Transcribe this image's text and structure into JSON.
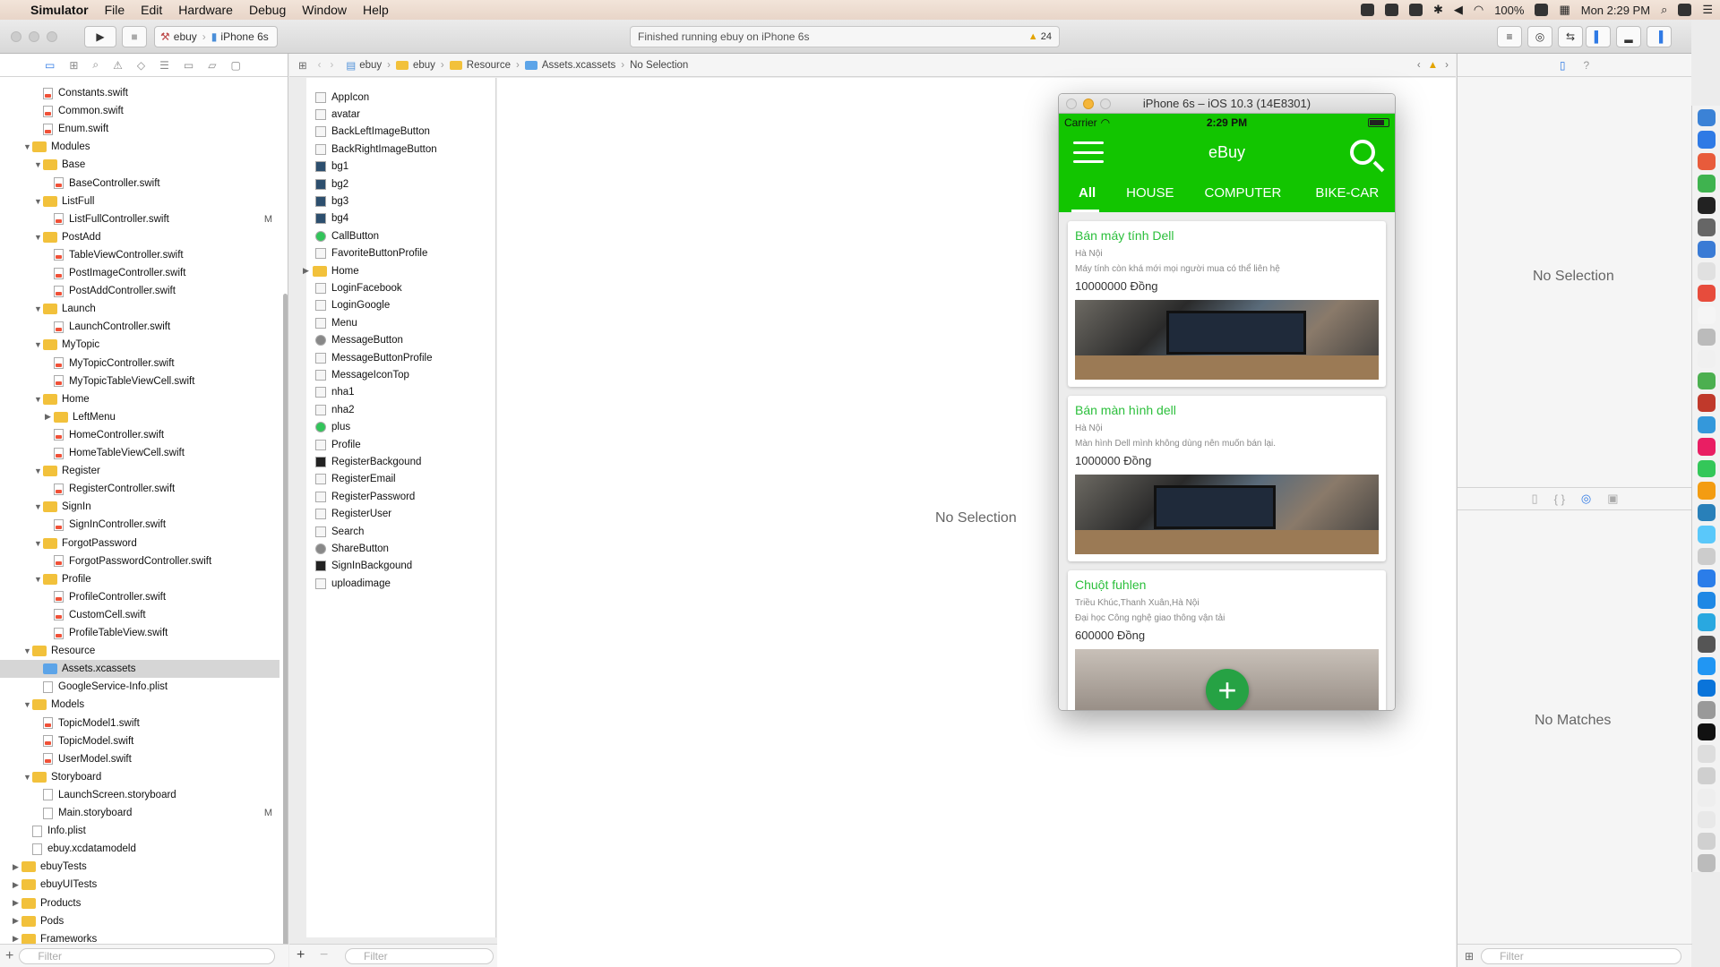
{
  "menubar": {
    "app": "Simulator",
    "items": [
      "File",
      "Edit",
      "Hardware",
      "Debug",
      "Window",
      "Help"
    ],
    "battery": "100%",
    "clock": "Mon 2:29 PM"
  },
  "toolbar": {
    "scheme": "ebuy",
    "device": "iPhone 6s",
    "status": "Finished running ebuy on iPhone 6s",
    "warnings": "24"
  },
  "navigator": {
    "rows": [
      {
        "label": "Constants.swift",
        "indent": 2,
        "kind": "swift"
      },
      {
        "label": "Common.swift",
        "indent": 2,
        "kind": "swift"
      },
      {
        "label": "Enum.swift",
        "indent": 2,
        "kind": "swift"
      },
      {
        "label": "Modules",
        "indent": 1,
        "kind": "folder",
        "open": true
      },
      {
        "label": "Base",
        "indent": 2,
        "kind": "folder",
        "open": true
      },
      {
        "label": "BaseController.swift",
        "indent": 3,
        "kind": "swift"
      },
      {
        "label": "ListFull",
        "indent": 2,
        "kind": "folder",
        "open": true
      },
      {
        "label": "ListFullController.swift",
        "indent": 3,
        "kind": "swift",
        "badge": "M"
      },
      {
        "label": "PostAdd",
        "indent": 2,
        "kind": "folder",
        "open": true
      },
      {
        "label": "TableViewController.swift",
        "indent": 3,
        "kind": "swift"
      },
      {
        "label": "PostImageController.swift",
        "indent": 3,
        "kind": "swift"
      },
      {
        "label": "PostAddController.swift",
        "indent": 3,
        "kind": "swift"
      },
      {
        "label": "Launch",
        "indent": 2,
        "kind": "folder",
        "open": true
      },
      {
        "label": "LaunchController.swift",
        "indent": 3,
        "kind": "swift"
      },
      {
        "label": "MyTopic",
        "indent": 2,
        "kind": "folder",
        "open": true
      },
      {
        "label": "MyTopicController.swift",
        "indent": 3,
        "kind": "swift"
      },
      {
        "label": "MyTopicTableViewCell.swift",
        "indent": 3,
        "kind": "swift"
      },
      {
        "label": "Home",
        "indent": 2,
        "kind": "folder",
        "open": true
      },
      {
        "label": "LeftMenu",
        "indent": 3,
        "kind": "folder",
        "open": false
      },
      {
        "label": "HomeController.swift",
        "indent": 3,
        "kind": "swift"
      },
      {
        "label": "HomeTableViewCell.swift",
        "indent": 3,
        "kind": "swift"
      },
      {
        "label": "Register",
        "indent": 2,
        "kind": "folder",
        "open": true
      },
      {
        "label": "RegisterController.swift",
        "indent": 3,
        "kind": "swift"
      },
      {
        "label": "SignIn",
        "indent": 2,
        "kind": "folder",
        "open": true
      },
      {
        "label": "SignInController.swift",
        "indent": 3,
        "kind": "swift"
      },
      {
        "label": "ForgotPassword",
        "indent": 2,
        "kind": "folder",
        "open": true
      },
      {
        "label": "ForgotPasswordController.swift",
        "indent": 3,
        "kind": "swift"
      },
      {
        "label": "Profile",
        "indent": 2,
        "kind": "folder",
        "open": true
      },
      {
        "label": "ProfileController.swift",
        "indent": 3,
        "kind": "swift"
      },
      {
        "label": "CustomCell.swift",
        "indent": 3,
        "kind": "swift"
      },
      {
        "label": "ProfileTableView.swift",
        "indent": 3,
        "kind": "swift"
      },
      {
        "label": "Resource",
        "indent": 1,
        "kind": "folder",
        "open": true
      },
      {
        "label": "Assets.xcassets",
        "indent": 2,
        "kind": "assets",
        "selected": true
      },
      {
        "label": "GoogleService-Info.plist",
        "indent": 2,
        "kind": "file"
      },
      {
        "label": "Models",
        "indent": 1,
        "kind": "folder",
        "open": true
      },
      {
        "label": "TopicModel1.swift",
        "indent": 2,
        "kind": "swift"
      },
      {
        "label": "TopicModel.swift",
        "indent": 2,
        "kind": "swift"
      },
      {
        "label": "UserModel.swift",
        "indent": 2,
        "kind": "swift"
      },
      {
        "label": "Storyboard",
        "indent": 1,
        "kind": "folder",
        "open": true
      },
      {
        "label": "LaunchScreen.storyboard",
        "indent": 2,
        "kind": "file"
      },
      {
        "label": "Main.storyboard",
        "indent": 2,
        "kind": "file",
        "badge": "M"
      },
      {
        "label": "Info.plist",
        "indent": 1,
        "kind": "file"
      },
      {
        "label": "ebuy.xcdatamodeld",
        "indent": 1,
        "kind": "file"
      },
      {
        "label": "ebuyTests",
        "indent": 0,
        "kind": "folder",
        "open": false
      },
      {
        "label": "ebuyUITests",
        "indent": 0,
        "kind": "folder",
        "open": false
      },
      {
        "label": "Products",
        "indent": 0,
        "kind": "folder",
        "open": false
      },
      {
        "label": "Pods",
        "indent": 0,
        "kind": "folder",
        "open": false
      },
      {
        "label": "Frameworks",
        "indent": 0,
        "kind": "folder",
        "open": false
      }
    ],
    "filter_placeholder": "Filter"
  },
  "jumpbar": {
    "crumbs": [
      "ebuy",
      "ebuy",
      "Resource",
      "Assets.xcassets",
      "No Selection"
    ]
  },
  "assets": {
    "items": [
      {
        "label": "AppIcon",
        "thumb": "plain"
      },
      {
        "label": "avatar",
        "thumb": "plain"
      },
      {
        "label": "BackLeftImageButton",
        "thumb": "plain"
      },
      {
        "label": "BackRightImageButton",
        "thumb": "plain"
      },
      {
        "label": "bg1",
        "thumb": "img"
      },
      {
        "label": "bg2",
        "thumb": "img"
      },
      {
        "label": "bg3",
        "thumb": "img"
      },
      {
        "label": "bg4",
        "thumb": "img"
      },
      {
        "label": "CallButton",
        "thumb": "green"
      },
      {
        "label": "FavoriteButtonProfile",
        "thumb": "plain"
      },
      {
        "label": "Home",
        "thumb": "folder"
      },
      {
        "label": "LoginFacebook",
        "thumb": "plain"
      },
      {
        "label": "LoginGoogle",
        "thumb": "plain"
      },
      {
        "label": "Menu",
        "thumb": "plain"
      },
      {
        "label": "MessageButton",
        "thumb": "gray"
      },
      {
        "label": "MessageButtonProfile",
        "thumb": "plain"
      },
      {
        "label": "MessageIconTop",
        "thumb": "plain"
      },
      {
        "label": "nha1",
        "thumb": "plain"
      },
      {
        "label": "nha2",
        "thumb": "plain"
      },
      {
        "label": "plus",
        "thumb": "green"
      },
      {
        "label": "Profile",
        "thumb": "plain"
      },
      {
        "label": "RegisterBackgound",
        "thumb": "dark"
      },
      {
        "label": "RegisterEmail",
        "thumb": "plain"
      },
      {
        "label": "RegisterPassword",
        "thumb": "plain"
      },
      {
        "label": "RegisterUser",
        "thumb": "plain"
      },
      {
        "label": "Search",
        "thumb": "plain"
      },
      {
        "label": "ShareButton",
        "thumb": "gray"
      },
      {
        "label": "SignInBackgound",
        "thumb": "dark"
      },
      {
        "label": "uploadimage",
        "thumb": "plain"
      }
    ],
    "filter_placeholder": "Filter"
  },
  "editor": {
    "empty": "No Selection"
  },
  "inspector": {
    "top_empty": "No Selection",
    "bottom_empty": "No Matches",
    "filter_placeholder": "Filter"
  },
  "simulator": {
    "window_title": "iPhone 6s – iOS 10.3 (14E8301)",
    "carrier": "Carrier",
    "time": "2:29 PM",
    "app_title": "eBuy",
    "tabs": [
      "All",
      "HOUSE",
      "COMPUTER",
      "BIKE-CAR"
    ],
    "active_tab": "All",
    "brand_color": "#12c500",
    "cards": [
      {
        "title": "Bán máy tính Dell",
        "location": "Hà Nội",
        "description": "Máy tính còn khá mới mọi người mua có thể liên hệ",
        "price": "10000000 Đồng"
      },
      {
        "title": "Bán màn hình dell",
        "location": "Hà Nội",
        "description": "Màn hình Dell mình không dùng nên muốn bán lại.",
        "price": "1000000 Đồng"
      },
      {
        "title": "Chuột fuhlen",
        "location": "Triều Khúc,Thanh Xuân,Hà Nội",
        "description": "Đại học Công nghệ giao thông vận tải",
        "price": "600000 Đồng"
      }
    ]
  }
}
